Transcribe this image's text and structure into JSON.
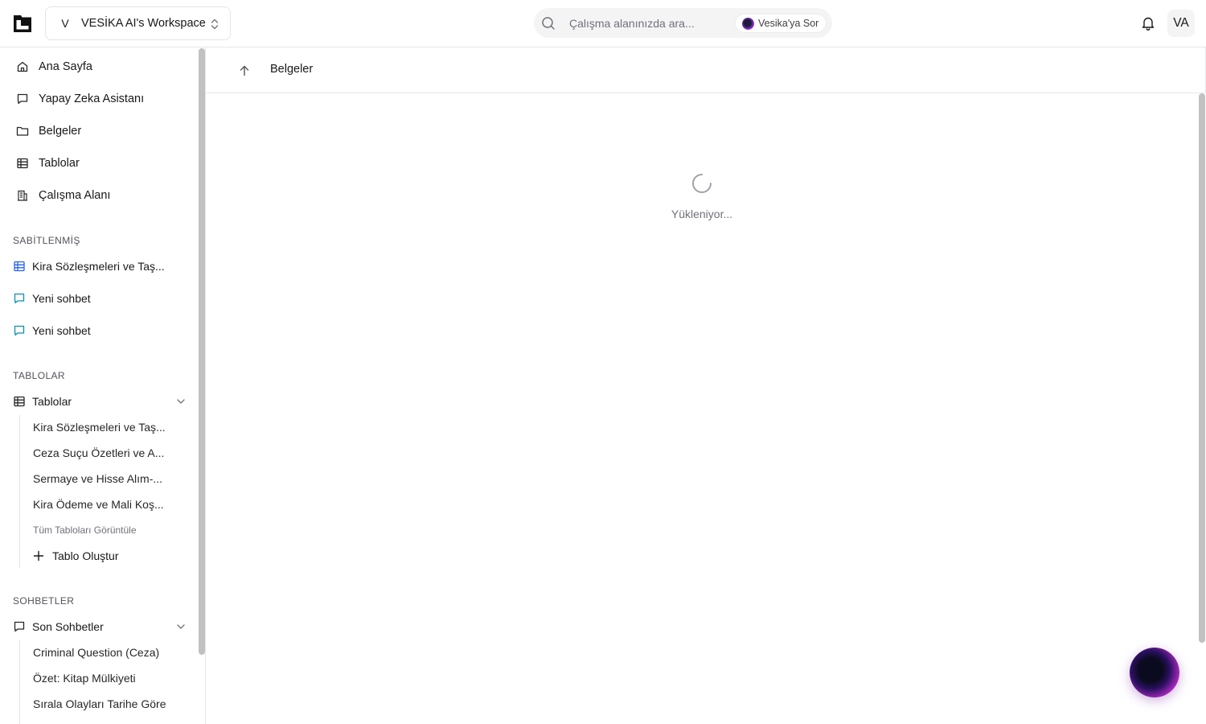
{
  "topbar": {
    "workspace_initial": "V",
    "workspace_name": "VESİKA AI's Workspace",
    "search_placeholder": "Çalışma alanınızda ara...",
    "ask_label": "Vesika'ya Sor",
    "user_initials": "VA"
  },
  "sidebar": {
    "nav": [
      {
        "label": "Ana Sayfa",
        "icon": "home-icon"
      },
      {
        "label": "Yapay Zeka Asistanı",
        "icon": "chat-icon"
      },
      {
        "label": "Belgeler",
        "icon": "folder-icon"
      },
      {
        "label": "Tablolar",
        "icon": "table-icon"
      },
      {
        "label": "Çalışma Alanı",
        "icon": "building-icon"
      }
    ],
    "pinned_label": "SABİTLENMİŞ",
    "pinned": [
      {
        "label": "Kira Sözleşmeleri ve Taş...",
        "icon": "table-icon",
        "color": "#2563eb"
      },
      {
        "label": "Yeni sohbet",
        "icon": "chat-icon",
        "color": "#0891b2"
      },
      {
        "label": "Yeni sohbet",
        "icon": "chat-icon",
        "color": "#0891b2"
      }
    ],
    "tables_section_label": "TABLOLAR",
    "tables_group_label": "Tablolar",
    "tables": [
      "Kira Sözleşmeleri ve Taş...",
      "Ceza Suçu Özetleri ve A...",
      "Sermaye ve Hisse Alım-...",
      "Kira Ödeme ve Mali Koş..."
    ],
    "view_all_tables": "Tüm Tabloları Görüntüle",
    "create_table": "Tablo Oluştur",
    "chats_section_label": "SOHBETLER",
    "chats_group_label": "Son Sohbetler",
    "chats": [
      "Criminal Question (Ceza)",
      "Özet: Kitap Mülkiyeti",
      "Sırala Olayları Tarihe Göre"
    ]
  },
  "main": {
    "breadcrumb": "Belgeler",
    "loading_text": "Yükleniyor..."
  }
}
